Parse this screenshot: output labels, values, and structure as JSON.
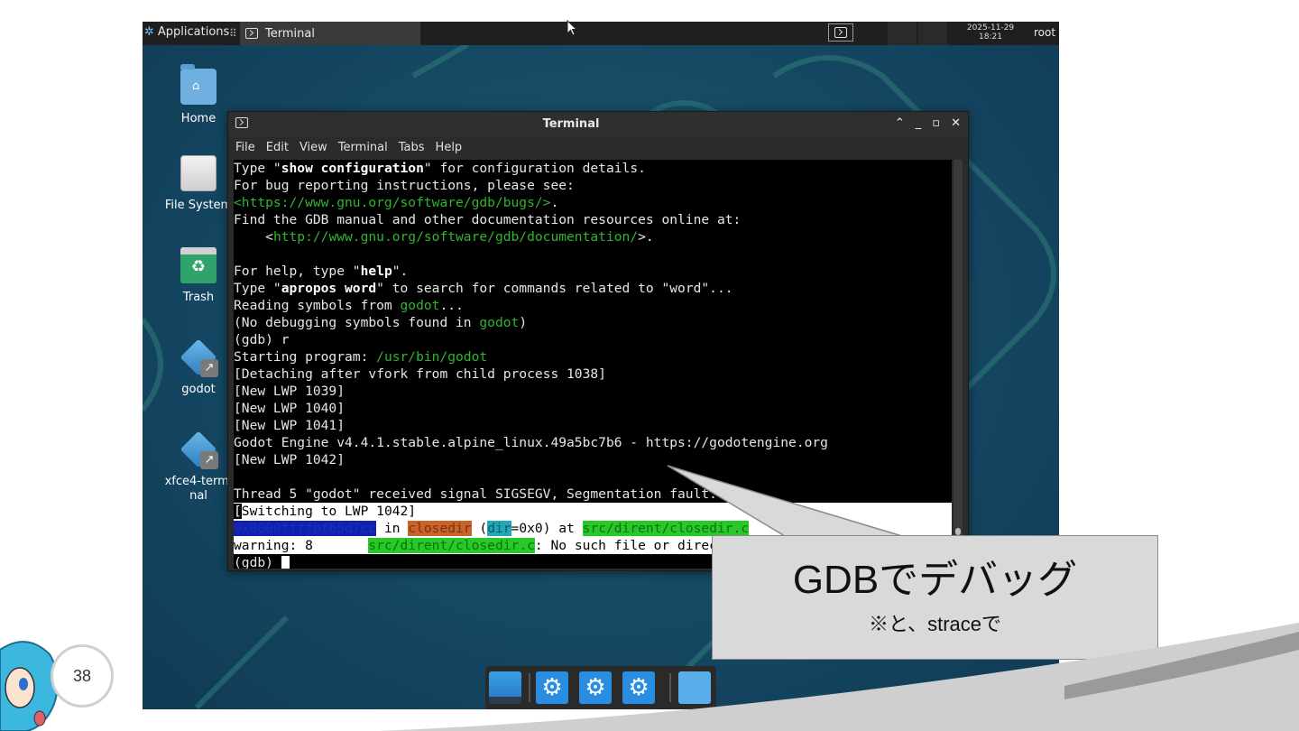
{
  "panel": {
    "applications_label": "Applications",
    "task_label": "Terminal",
    "clock_date": "2025-11-29",
    "clock_time": "18:21",
    "user_label": "root"
  },
  "desktop_icons": [
    {
      "label": "Home"
    },
    {
      "label": "File System"
    },
    {
      "label": "Trash"
    },
    {
      "label": "godot"
    },
    {
      "label": "xfce4-terminal"
    }
  ],
  "window": {
    "title": "Terminal",
    "menu": [
      "File",
      "Edit",
      "View",
      "Terminal",
      "Tabs",
      "Help"
    ]
  },
  "terminal": {
    "l1a": "Type \"",
    "l1b": "show configuration",
    "l1c": "\" for configuration details.",
    "l2": "For bug reporting instructions, please see:",
    "l3a": "<https://www.gnu.org/software/gdb/bugs/>",
    "l3b": ".",
    "l4": "Find the GDB manual and other documentation resources online at:",
    "l5a": "    <",
    "l5b": "http://www.gnu.org/software/gdb/documentation/",
    "l5c": ">.",
    "l6": "",
    "l7a": "For help, type \"",
    "l7b": "help",
    "l7c": "\".",
    "l8a": "Type \"",
    "l8b": "apropos word",
    "l8c": "\" to search for commands related to \"word\"...",
    "l9a": "Reading symbols from ",
    "l9b": "godot",
    "l9c": "...",
    "l10a": "(No debugging symbols found in ",
    "l10b": "godot",
    "l10c": ")",
    "l11": "(gdb) r",
    "l12a": "Starting program: ",
    "l12b": "/usr/bin/godot",
    "l13": "[Detaching after vfork from child process 1038]",
    "l14": "[New LWP 1039]",
    "l15": "[New LWP 1040]",
    "l16": "[New LWP 1041]",
    "l17": "Godot Engine v4.4.1.stable.alpine_linux.49a5bc7b6 - https://godotengine.org",
    "l18": "[New LWP 1042]",
    "l19": "",
    "l20": "Thread 5 \"godot\" received signal SIGSEGV, Segmentation fault.",
    "l21a": "[",
    "l21b": "Switching to LWP 1042]",
    "l22a": "0x0000ffffbf65d7cc",
    "l22b": " in ",
    "l22c": "closedir",
    "l22d": " (",
    "l22e": "dir",
    "l22f": "=0x0) at ",
    "l22g": "src/dirent/closedir.c",
    "l23a": "warning: 8       ",
    "l23b": "src/dirent/closedir.c",
    "l23c": ": No such file or directory",
    "l24": "(gdb) "
  },
  "callout": {
    "title": "GDBでデバッグ",
    "subtitle": "※と、straceで"
  },
  "slide": {
    "page_number": "38"
  }
}
